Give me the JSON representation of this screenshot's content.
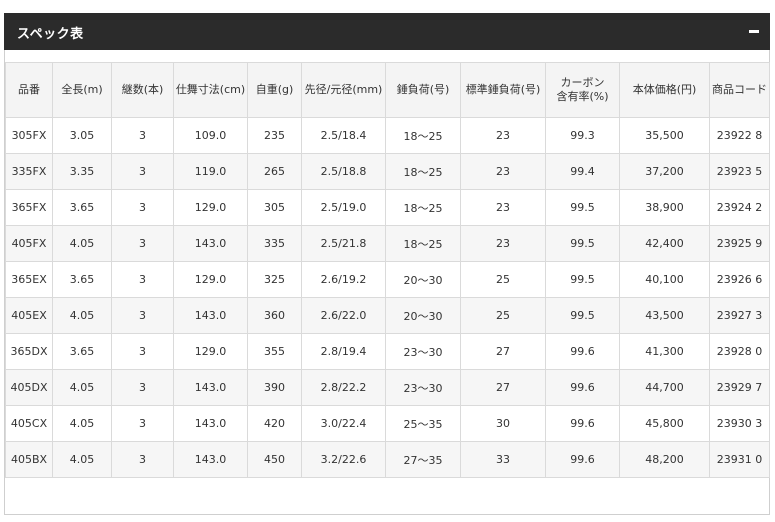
{
  "panel": {
    "title": "スペック表"
  },
  "table": {
    "headers": [
      "品番",
      "全長(m)",
      "継数(本)",
      "仕舞寸法(cm)",
      "自重(g)",
      "先径/元径(mm)",
      "錘負荷(号)",
      "標準錘負荷(号)",
      "カーボン\n含有率(%)",
      "本体価格(円)",
      "商品コード"
    ],
    "rows": [
      [
        "305FX",
        "3.05",
        "3",
        "109.0",
        "235",
        "2.5/18.4",
        "18〜25",
        "23",
        "99.3",
        "35,500",
        "23922 8"
      ],
      [
        "335FX",
        "3.35",
        "3",
        "119.0",
        "265",
        "2.5/18.8",
        "18〜25",
        "23",
        "99.4",
        "37,200",
        "23923 5"
      ],
      [
        "365FX",
        "3.65",
        "3",
        "129.0",
        "305",
        "2.5/19.0",
        "18〜25",
        "23",
        "99.5",
        "38,900",
        "23924 2"
      ],
      [
        "405FX",
        "4.05",
        "3",
        "143.0",
        "335",
        "2.5/21.8",
        "18〜25",
        "23",
        "99.5",
        "42,400",
        "23925 9"
      ],
      [
        "365EX",
        "3.65",
        "3",
        "129.0",
        "325",
        "2.6/19.2",
        "20〜30",
        "25",
        "99.5",
        "40,100",
        "23926 6"
      ],
      [
        "405EX",
        "4.05",
        "3",
        "143.0",
        "360",
        "2.6/22.0",
        "20〜30",
        "25",
        "99.5",
        "43,500",
        "23927 3"
      ],
      [
        "365DX",
        "3.65",
        "3",
        "129.0",
        "355",
        "2.8/19.4",
        "23〜30",
        "27",
        "99.6",
        "41,300",
        "23928 0"
      ],
      [
        "405DX",
        "4.05",
        "3",
        "143.0",
        "390",
        "2.8/22.2",
        "23〜30",
        "27",
        "99.6",
        "44,700",
        "23929 7"
      ],
      [
        "405CX",
        "4.05",
        "3",
        "143.0",
        "420",
        "3.0/22.4",
        "25〜35",
        "30",
        "99.6",
        "45,800",
        "23930 3"
      ],
      [
        "405BX",
        "4.05",
        "3",
        "143.0",
        "450",
        "3.2/22.6",
        "27〜35",
        "33",
        "99.6",
        "48,200",
        "23931 0"
      ]
    ]
  }
}
